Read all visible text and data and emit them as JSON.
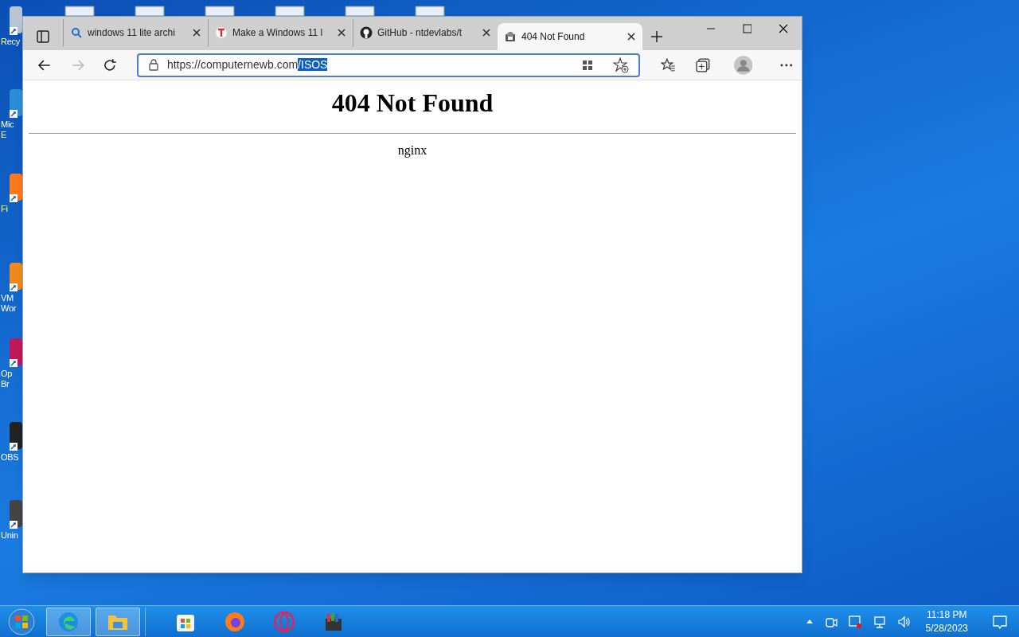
{
  "desktop": {
    "icons": [
      {
        "label": "Recy"
      },
      {
        "label": "Mic\nE"
      },
      {
        "label": "Fi"
      },
      {
        "label": "VM\nWor"
      },
      {
        "label": "Op\nBr"
      },
      {
        "label": "OBS"
      },
      {
        "label": "Unin"
      }
    ]
  },
  "browser": {
    "tabs": [
      {
        "label": "windows 11 lite archi",
        "kind": "search",
        "selected": false
      },
      {
        "label": "Make a Windows 11 l",
        "kind": "letter",
        "selected": false
      },
      {
        "label": "GitHub - ntdevlabs/t",
        "kind": "github",
        "selected": false
      },
      {
        "label": "404 Not Found",
        "kind": "page",
        "selected": true
      }
    ],
    "address": {
      "text": "https://computernewb.com",
      "selected_text": "/ISOS"
    },
    "page": {
      "heading": "404 Not Found",
      "footer": "nginx"
    }
  },
  "taskbar": {
    "apps": [
      {
        "kind": "edge",
        "active": true
      },
      {
        "kind": "folder",
        "active": true
      },
      {
        "kind": "store",
        "active": false
      },
      {
        "kind": "firefox",
        "active": false
      },
      {
        "kind": "opera",
        "active": false
      },
      {
        "kind": "archive",
        "active": false
      }
    ],
    "time": "11:18 PM",
    "date": "5/28/2023"
  }
}
